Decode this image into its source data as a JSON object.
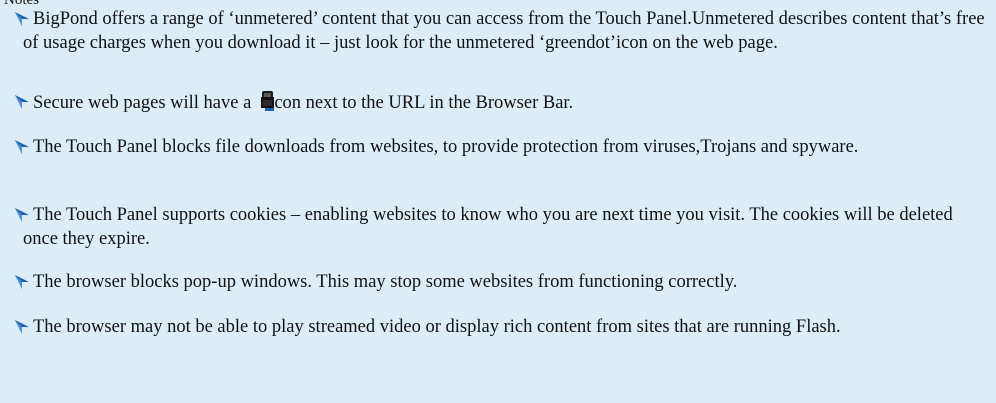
{
  "heading": "Notes",
  "colors": {
    "background": "#dcedf8",
    "bullet": "#1f5fb4",
    "text": "#111111"
  },
  "bullet_icon": "blue-arrow-bullet-icon",
  "notes": [
    {
      "text": "BigPond offers a range of ‘unmetered’ content that you can access from the Touch Panel.Unmetered describes content that’s free of usage charges when you download it – just look for the unmetered ‘greendot’icon on the web page."
    },
    {
      "text_before": "Secure web pages will have a",
      "inline_icon": "lock-icon",
      "text_after": "con next to the URL in the Browser Bar."
    },
    {
      "text": "The Touch Panel blocks file downloads from websites, to provide protection from viruses,Trojans and spyware."
    },
    {
      "text": "The Touch Panel supports cookies – enabling websites to know who you are next time you visit. The cookies will be deleted once they expire."
    },
    {
      "text": "The browser blocks pop-up windows. This may stop some websites from functioning correctly."
    },
    {
      "text": "The browser may not be able to play streamed video or display rich content from sites that are running Flash."
    }
  ]
}
